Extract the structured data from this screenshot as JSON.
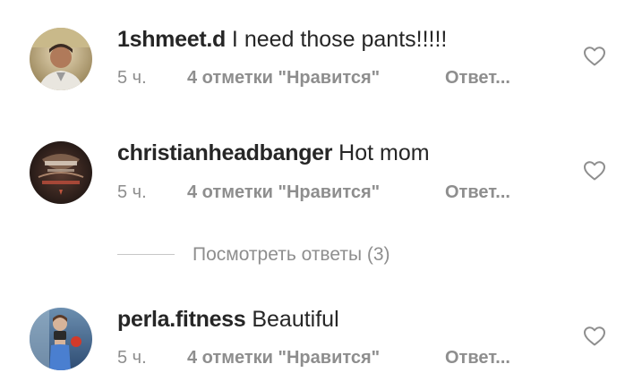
{
  "comments": [
    {
      "username": "1shmeet.d",
      "text": "I need those pants!!!!!",
      "time": "5 ч.",
      "likes": "4 отметки \"Нравится\"",
      "reply": "Ответ..."
    },
    {
      "username": "christianheadbanger",
      "text": "Hot mom",
      "time": "5 ч.",
      "likes": "4 отметки \"Нравится\"",
      "reply": "Ответ..."
    },
    {
      "username": "perla.fitness",
      "text": "Beautiful",
      "time": "5 ч.",
      "likes": "4 отметки \"Нравится\"",
      "reply": "Ответ..."
    }
  ],
  "view_replies": {
    "label": "Посмотреть ответы (3)"
  },
  "colors": {
    "primary_text": "#262626",
    "secondary_text": "#8e8e8e",
    "divider": "#c7c7c7",
    "background": "#ffffff"
  },
  "icons": {
    "like": "heart-outline-icon"
  }
}
